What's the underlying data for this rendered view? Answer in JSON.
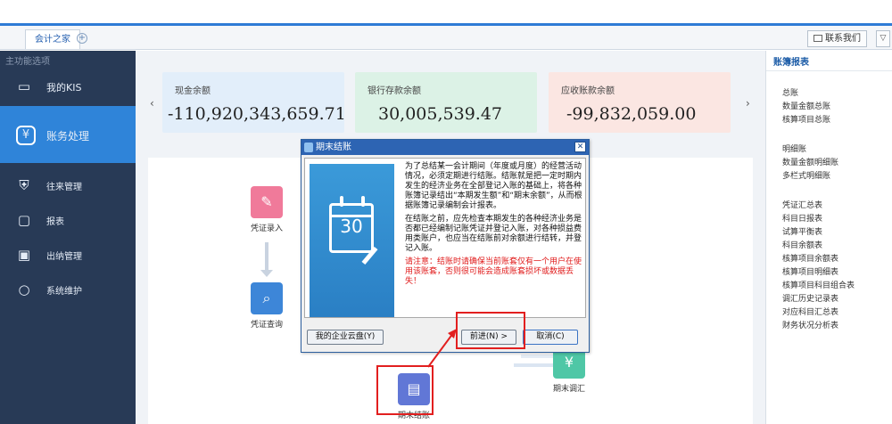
{
  "tabs": {
    "active": "会计之家",
    "add_symbol": "+"
  },
  "header": {
    "contact_label": "联系我们",
    "dropdown_symbol": "▽"
  },
  "sidebar": {
    "title": "主功能选项",
    "items": [
      {
        "label": "我的KIS",
        "icon": "monitor-icon"
      },
      {
        "label": "账务处理",
        "icon": "yen-circle-icon",
        "active": true
      },
      {
        "label": "往来管理",
        "icon": "shield-yen-icon"
      },
      {
        "label": "报表",
        "icon": "chart-icon"
      },
      {
        "label": "出纳管理",
        "icon": "cashier-icon"
      },
      {
        "label": "系统维护",
        "icon": "maintenance-icon"
      }
    ]
  },
  "summary_cards": {
    "nav_prev": "‹",
    "nav_next": "›",
    "cash": {
      "title": "现金余额",
      "value": "-110,920,343,659.71"
    },
    "bank": {
      "title": "银行存款余额",
      "value": "30,005,539.47"
    },
    "receivable": {
      "title": "应收账款余额",
      "value": "-99,832,059.00"
    }
  },
  "flow": {
    "voucher_entry": "凭证录入",
    "voucher_query": "凭证查询",
    "period_end": "期末结账",
    "period_adjust": "期末调汇"
  },
  "dialog": {
    "title": "期末结账",
    "close_symbol": "✕",
    "calendar_number": "30",
    "paragraph1": "为了总结某一会计期间（年度或月度）的经营活动情况，必须定期进行结账。结账就是把一定时期内发生的经济业务在全部登记入账的基础上，将各种账簿记录结出“本期发生额”和“期末余额”，从而根据账簿记录编制会计报表。",
    "paragraph2": "在结账之前，应先检查本期发生的各种经济业务是否都已经编制记账凭证并登记入账，对各种损益费用类账户，也应当在结账前对余额进行结转，并登记入账。",
    "warning": "请注意：结账时请确保当前账套仅有一个用户在使用该账套，否则很可能会造成账套损坏或数据丢失！",
    "btn_cloud": "我的企业云盘(Y)",
    "btn_next": "前进(N) >",
    "btn_cancel": "取消(C)"
  },
  "right_panel": {
    "title": "账簿报表",
    "group1": [
      "总账",
      "数量金额总账",
      "核算项目总账"
    ],
    "group2": [
      "明细账",
      "数量金额明细账",
      "多栏式明细账"
    ],
    "group3": [
      "凭证汇总表",
      "科目日报表",
      "试算平衡表",
      "科目余额表",
      "核算项目余额表",
      "核算项目明细表",
      "核算项目科目组合表",
      "调汇历史记录表",
      "对应科目汇总表",
      "财务状况分析表"
    ]
  }
}
